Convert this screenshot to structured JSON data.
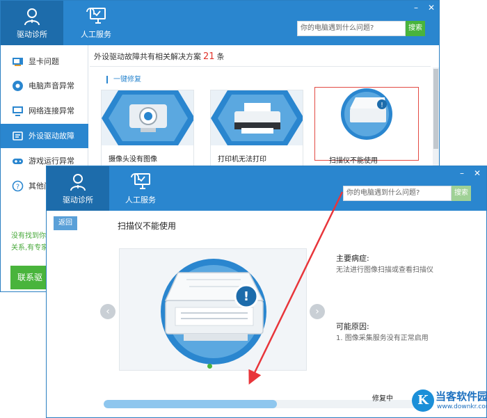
{
  "back_window": {
    "nav": {
      "diagnose_label": "驱动诊所",
      "service_label": "人工服务"
    },
    "controls": {
      "minimize": "–",
      "close": "✕"
    },
    "search": {
      "placeholder": "你的电脑遇到什么问题?",
      "button_label": "搜索"
    },
    "sidebar": {
      "items": [
        {
          "label": "显卡问题",
          "icon": "display-card-icon"
        },
        {
          "label": "电脑声音异常",
          "icon": "speaker-icon"
        },
        {
          "label": "网络连接异常",
          "icon": "monitor-icon"
        },
        {
          "label": "外设驱动故障",
          "icon": "peripheral-icon"
        },
        {
          "label": "游戏运行异常",
          "icon": "gamepad-icon"
        },
        {
          "label": "其他问",
          "icon": "question-icon"
        }
      ],
      "active_index": 3,
      "note_line1": "没有找到你",
      "note_line2": "关系,有专家",
      "contact_label": "联系驱"
    },
    "summary_prefix": "外设驱动故障共有相关解决方案",
    "summary_count": "21",
    "summary_suffix": "条",
    "section_title": "一键修复",
    "cards": [
      {
        "title": "摄像头没有图像",
        "icon": "webcam-icon"
      },
      {
        "title": "打印机无法打印",
        "icon": "printer-icon"
      },
      {
        "title": "扫描仪不能使用",
        "icon": "scanner-icon"
      }
    ],
    "selected_card_index": 2
  },
  "front_window": {
    "nav": {
      "diagnose_label": "驱动诊所",
      "service_label": "人工服务"
    },
    "controls": {
      "minimize": "–",
      "close": "✕"
    },
    "search": {
      "placeholder": "你的电脑遇到什么问题?",
      "button_label": "搜索"
    },
    "back_label": "返回",
    "title": "扫描仪不能使用",
    "symptom_heading": "主要病症:",
    "symptom_text": "无法进行图像扫描或查看扫描仪",
    "cause_heading": "可能原因:",
    "cause_text": "1. 图像采集服务没有正常启用",
    "progress_label": "修复中",
    "progress_fraction": 0.53,
    "carousel_dots": 1
  },
  "watermark": {
    "name": "当客软件园",
    "url": "www.downkr.com",
    "logo_glyph": "K"
  },
  "colors": {
    "title_blue": "#2a86cf",
    "nav_active": "#1d6cab",
    "green": "#49b43c",
    "red_accent": "#e0322a",
    "annotation_arrow": "#e8353a"
  }
}
